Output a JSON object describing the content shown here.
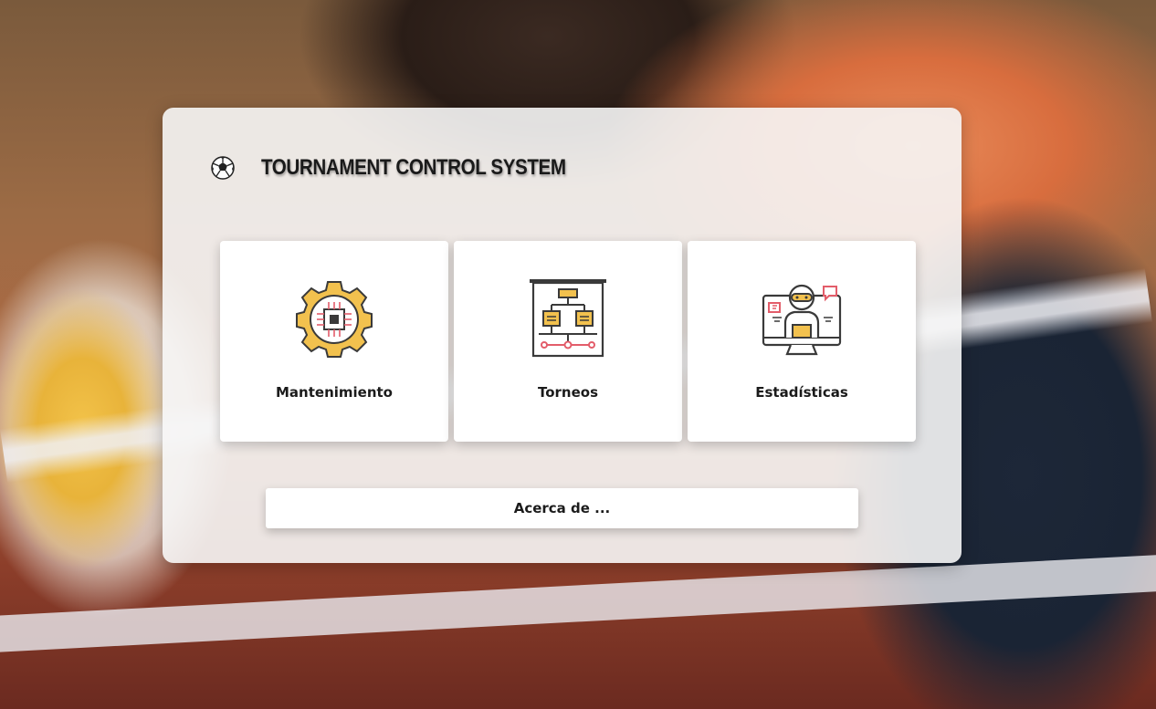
{
  "app": {
    "title": "TOURNAMENT CONTROL SYSTEM",
    "logo_icon": "soccer-ball-icon"
  },
  "cards": [
    {
      "label": "Mantenimiento",
      "icon": "gear-chip-icon"
    },
    {
      "label": "Torneos",
      "icon": "tournament-bracket-icon"
    },
    {
      "label": "Estadísticas",
      "icon": "monitor-user-stats-icon"
    }
  ],
  "about_button": {
    "label": "Acerca de ..."
  },
  "colors": {
    "accent_yellow": "#F2C14E",
    "accent_red": "#E35D6A",
    "icon_dark": "#3A3A3A",
    "panel": "#F6F6F6"
  }
}
